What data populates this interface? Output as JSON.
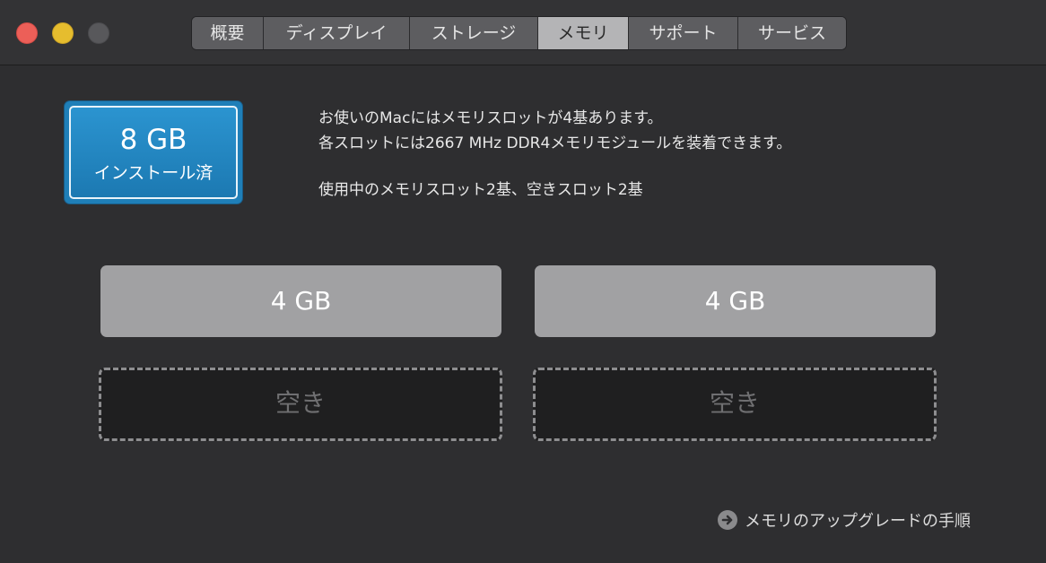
{
  "window": {
    "traffic_lights": [
      "close",
      "minimize",
      "zoom"
    ]
  },
  "tabs": [
    {
      "label": "概要",
      "active": false
    },
    {
      "label": "ディスプレイ",
      "active": false
    },
    {
      "label": "ストレージ",
      "active": false
    },
    {
      "label": "メモリ",
      "active": true
    },
    {
      "label": "サポート",
      "active": false
    },
    {
      "label": "サービス",
      "active": false
    }
  ],
  "memory": {
    "installed_size": "8 GB",
    "installed_label": "インストール済",
    "info_line1": "お使いのMacにはメモリスロットが4基あります。",
    "info_line2": "各スロットには2667 MHz DDR4メモリモジュールを装着できます。",
    "info_line3": "使用中のメモリスロット2基、空きスロット2基",
    "slots": [
      {
        "label": "4 GB",
        "state": "filled"
      },
      {
        "label": "4 GB",
        "state": "filled"
      },
      {
        "label": "空き",
        "state": "empty"
      },
      {
        "label": "空き",
        "state": "empty"
      }
    ],
    "upgrade_link": "メモリのアップグレードの手順"
  },
  "colors": {
    "accent": "#1f7fb8",
    "window_bg": "#2e2e30",
    "slot_filled": "#a1a1a3",
    "slot_empty": "#1f1f20"
  },
  "icons": {
    "upgrade": "arrow-right-circle-icon"
  }
}
